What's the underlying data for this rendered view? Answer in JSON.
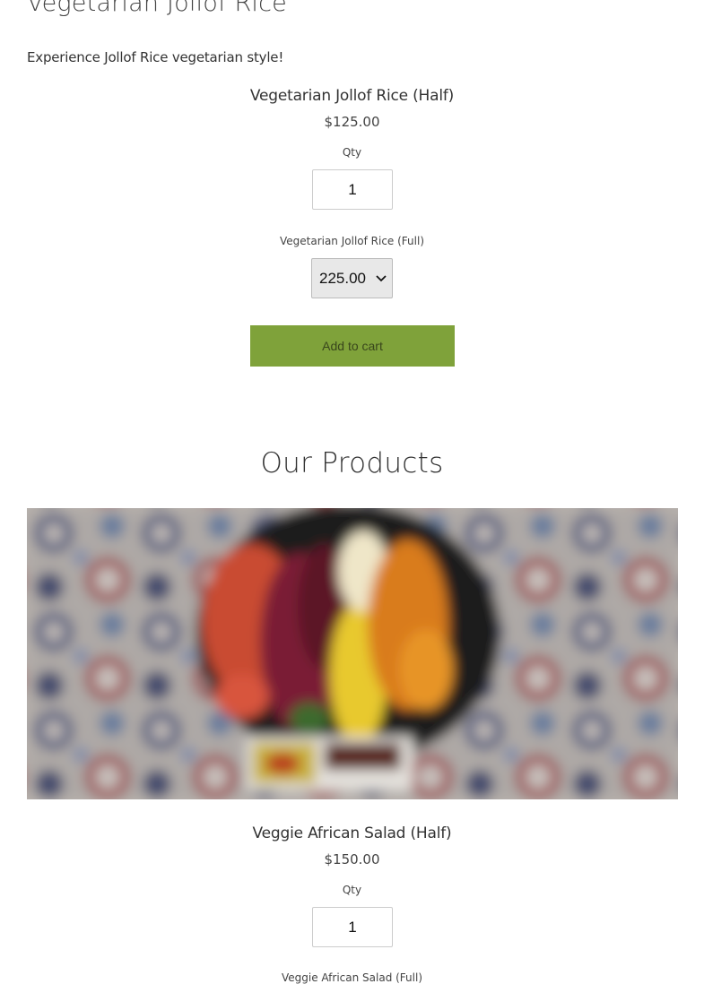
{
  "section": {
    "title": "Vegetarian Jollof Rice",
    "description": "Experience Jollof Rice vegetarian style!"
  },
  "product1": {
    "name": "Vegetarian Jollof Rice (Half)",
    "price": "$125.00",
    "qty_label": "Qty",
    "qty_value": "1",
    "variant_label": "Vegetarian Jollof Rice (Full)",
    "variant_value": "225.00",
    "add_to_cart": "Add to cart"
  },
  "products_heading": "Our Products",
  "product2": {
    "image_icon": "salad-bowl-photo",
    "name": "Veggie African Salad (Half)",
    "price": "$150.00",
    "qty_label": "Qty",
    "qty_value": "1",
    "variant_label": "Veggie African Salad (Full)"
  },
  "colors": {
    "accent_button": "#7fa23a",
    "text": "#333333"
  }
}
